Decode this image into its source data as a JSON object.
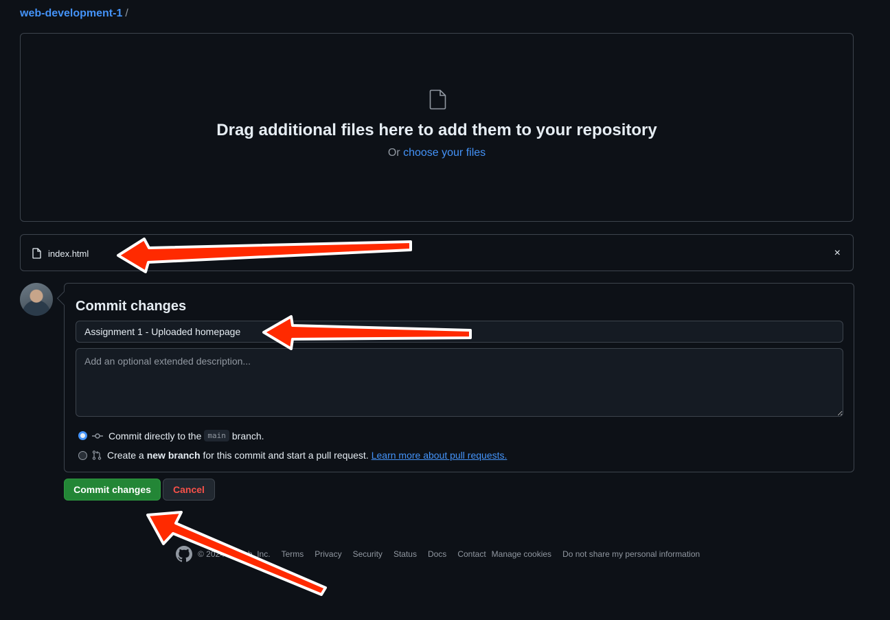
{
  "breadcrumb": {
    "repo": "web-development-1",
    "separator": "/"
  },
  "dropzone": {
    "headline": "Drag additional files here to add them to your repository",
    "or_text": "Or",
    "choose_link": "choose your files"
  },
  "file": {
    "name": "index.html",
    "remove_symbol": "×"
  },
  "commit": {
    "title": "Commit changes",
    "summary_value": "Assignment 1 - Uploaded homepage",
    "description_placeholder": "Add an optional extended description...",
    "option_direct": {
      "prefix": "Commit directly to the",
      "branch": "main",
      "suffix": "branch.",
      "selected": true
    },
    "option_new": {
      "prefix": "Create a",
      "bold": "new branch",
      "suffix": "for this commit and start a pull request.",
      "link": "Learn more about pull requests.",
      "selected": false
    }
  },
  "buttons": {
    "commit": "Commit changes",
    "cancel": "Cancel"
  },
  "footer": {
    "copyright": "© 2024 GitHub, Inc.",
    "links": [
      "Terms",
      "Privacy",
      "Security",
      "Status",
      "Docs",
      "Contact",
      "Manage cookies",
      "Do not share my personal information"
    ]
  },
  "colors": {
    "background": "#0d1117",
    "link": "#4493f8",
    "primary_button": "#238636",
    "danger_text": "#f85149",
    "annotation_arrow": "#ff2a00"
  },
  "icons": [
    "file-icon",
    "close-icon",
    "commit-icon",
    "pull-request-icon",
    "github-logo-icon"
  ]
}
